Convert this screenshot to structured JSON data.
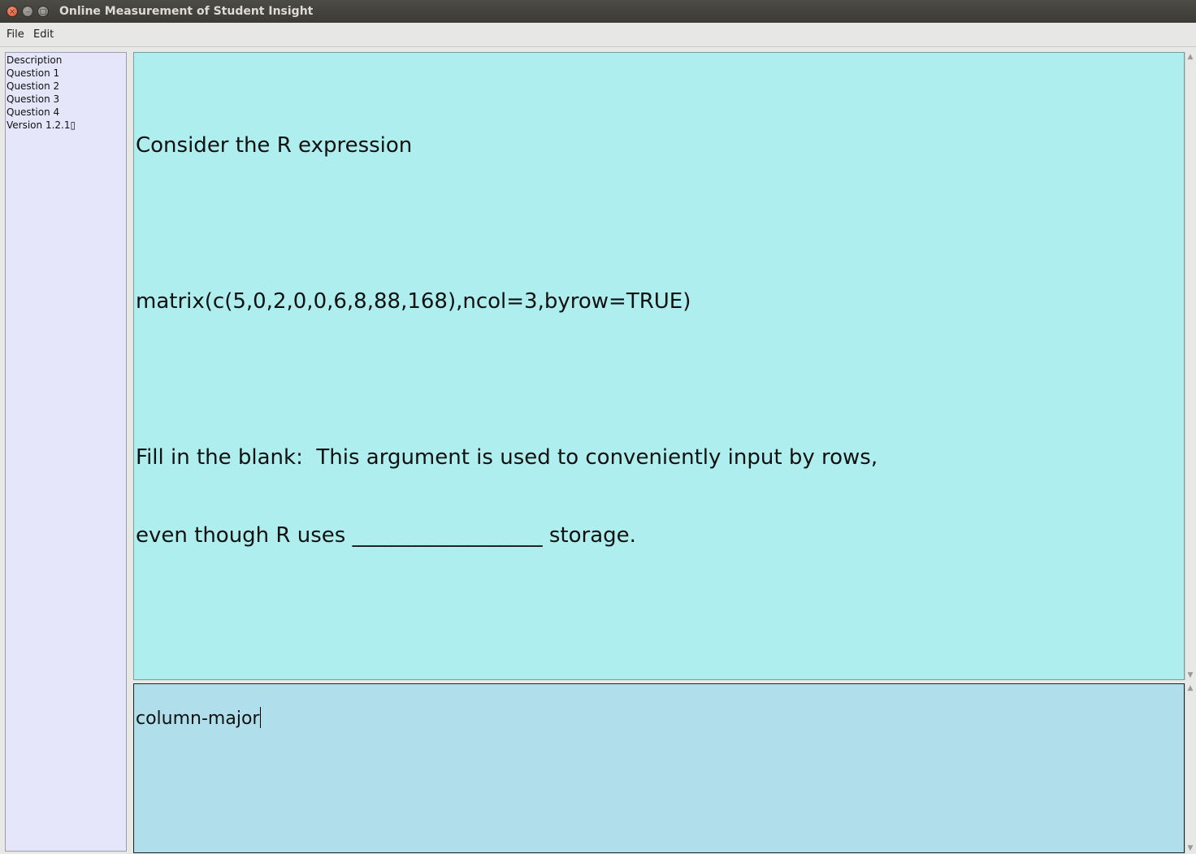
{
  "window": {
    "title": "Online Measurement of Student Insight",
    "controls": {
      "close": "×",
      "minimize": "–",
      "maximize": "□"
    }
  },
  "menubar": {
    "items": [
      {
        "label": "File"
      },
      {
        "label": "Edit"
      }
    ]
  },
  "sidebar": {
    "items": [
      {
        "label": "Description"
      },
      {
        "label": "Question 1"
      },
      {
        "label": "Question 2"
      },
      {
        "label": "Question 3"
      },
      {
        "label": "Question 4"
      },
      {
        "label": "Version 1.2.1▯"
      }
    ]
  },
  "question": {
    "lines": [
      "Consider the R expression",
      "",
      "matrix(c(5,0,2,0,0,6,8,88,168),ncol=3,byrow=TRUE)",
      "",
      "Fill in the blank:  This argument is used to conveniently input by rows,",
      "even though R uses __________________ storage."
    ]
  },
  "answer": {
    "value": "column-major"
  },
  "colors": {
    "question_bg": "#afeeee",
    "answer_bg": "#b0dfeb",
    "sidebar_bg": "#e6e6fa"
  }
}
